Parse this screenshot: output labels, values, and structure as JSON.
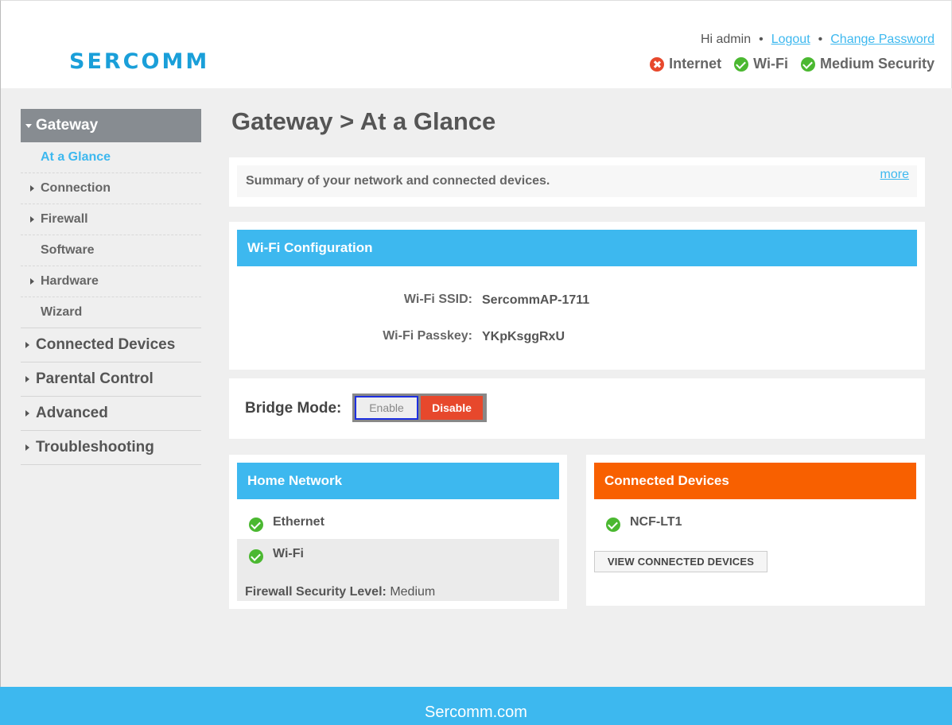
{
  "header": {
    "logo": "SERCOMM",
    "greeting": "Hi admin",
    "separator": "•",
    "logout_label": "Logout",
    "change_password_label": "Change Password",
    "status": [
      {
        "label": "Internet",
        "state": "error",
        "icon": "error-icon"
      },
      {
        "label": "Wi-Fi",
        "state": "ok",
        "icon": "check-icon"
      },
      {
        "label": "Medium Security",
        "state": "ok",
        "icon": "check-icon"
      }
    ]
  },
  "sidebar": {
    "active_section": "Gateway",
    "sub_items": [
      {
        "label": "At a Glance",
        "active": true,
        "arrow": false
      },
      {
        "label": "Connection",
        "active": false,
        "arrow": true
      },
      {
        "label": "Firewall",
        "active": false,
        "arrow": true
      },
      {
        "label": "Software",
        "active": false,
        "arrow": false
      },
      {
        "label": "Hardware",
        "active": false,
        "arrow": true
      },
      {
        "label": "Wizard",
        "active": false,
        "arrow": false
      }
    ],
    "main_items": [
      "Connected Devices",
      "Parental Control",
      "Advanced",
      "Troubleshooting"
    ]
  },
  "main": {
    "title": "Gateway > At a Glance",
    "summary": {
      "text": "Summary of your network and connected devices.",
      "more_label": "more"
    },
    "wifi_config": {
      "title": "Wi-Fi Configuration",
      "ssid_label": "Wi-Fi SSID:",
      "ssid_value": "SercommAP-1711",
      "passkey_label": "Wi-Fi Passkey:",
      "passkey_value": "YKpKsggRxU"
    },
    "bridge_mode": {
      "label": "Bridge Mode:",
      "enable_label": "Enable",
      "disable_label": "Disable",
      "selected": "Disable"
    },
    "home_network": {
      "title": "Home Network",
      "items": [
        {
          "label": "Ethernet",
          "state": "ok"
        },
        {
          "label": "Wi-Fi",
          "state": "ok"
        }
      ],
      "firewall_label": "Firewall Security Level:",
      "firewall_value": "Medium"
    },
    "connected_devices": {
      "title": "Connected Devices",
      "devices": [
        {
          "name": "NCF-LT1",
          "state": "ok"
        }
      ],
      "view_button_label": "VIEW CONNECTED DEVICES"
    }
  },
  "footer": {
    "text": "Sercomm.com"
  },
  "colors": {
    "accent_blue": "#3db8ef",
    "accent_orange": "#f86000",
    "ok_green": "#4bb831",
    "error_red": "#e7482c",
    "nav_gray": "#878c91"
  }
}
